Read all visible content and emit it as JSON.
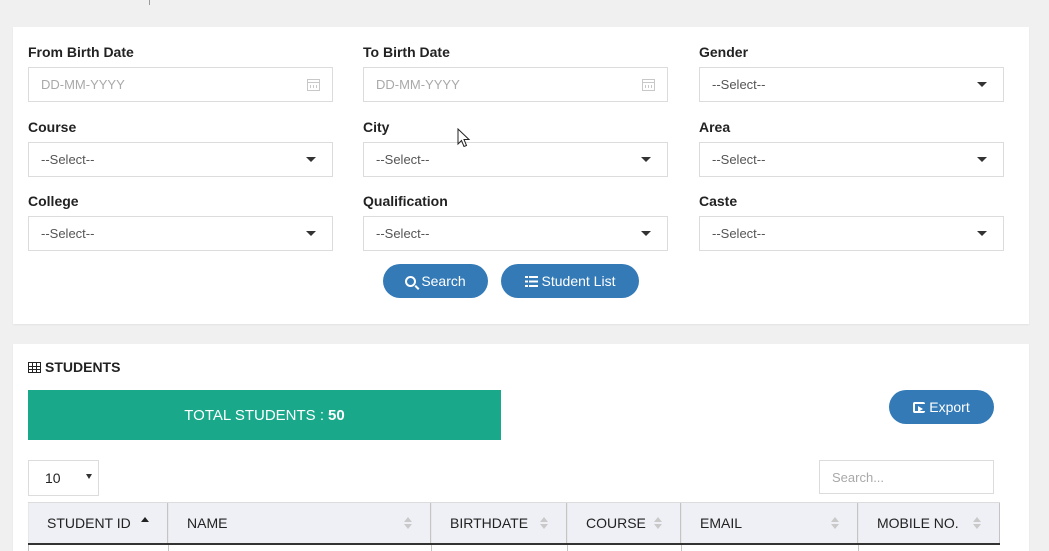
{
  "filters": {
    "from_birth_date": {
      "label": "From Birth Date",
      "placeholder": "DD-MM-YYYY"
    },
    "to_birth_date": {
      "label": "To Birth Date",
      "placeholder": "DD-MM-YYYY"
    },
    "gender": {
      "label": "Gender",
      "value": "--Select--"
    },
    "course": {
      "label": "Course",
      "value": "--Select--"
    },
    "city": {
      "label": "City",
      "value": "--Select--"
    },
    "area": {
      "label": "Area",
      "value": "--Select--"
    },
    "college": {
      "label": "College",
      "value": "--Select--"
    },
    "qualification": {
      "label": "Qualification",
      "value": "--Select--"
    },
    "caste": {
      "label": "Caste",
      "value": "--Select--"
    },
    "search_button": "Search",
    "student_list_button": "Student List"
  },
  "students": {
    "title": "STUDENTS",
    "total_label": "TOTAL STUDENTS :",
    "total_count": "50",
    "export_button": "Export",
    "page_length": "10",
    "search_placeholder": "Search...",
    "columns": [
      "STUDENT ID",
      "NAME",
      "BIRTHDATE",
      "COURSE",
      "EMAIL",
      "MOBILE NO."
    ]
  },
  "colors": {
    "primary": "#337ab7",
    "total_banner": "#1aa88a",
    "background": "#f0f0f0"
  }
}
